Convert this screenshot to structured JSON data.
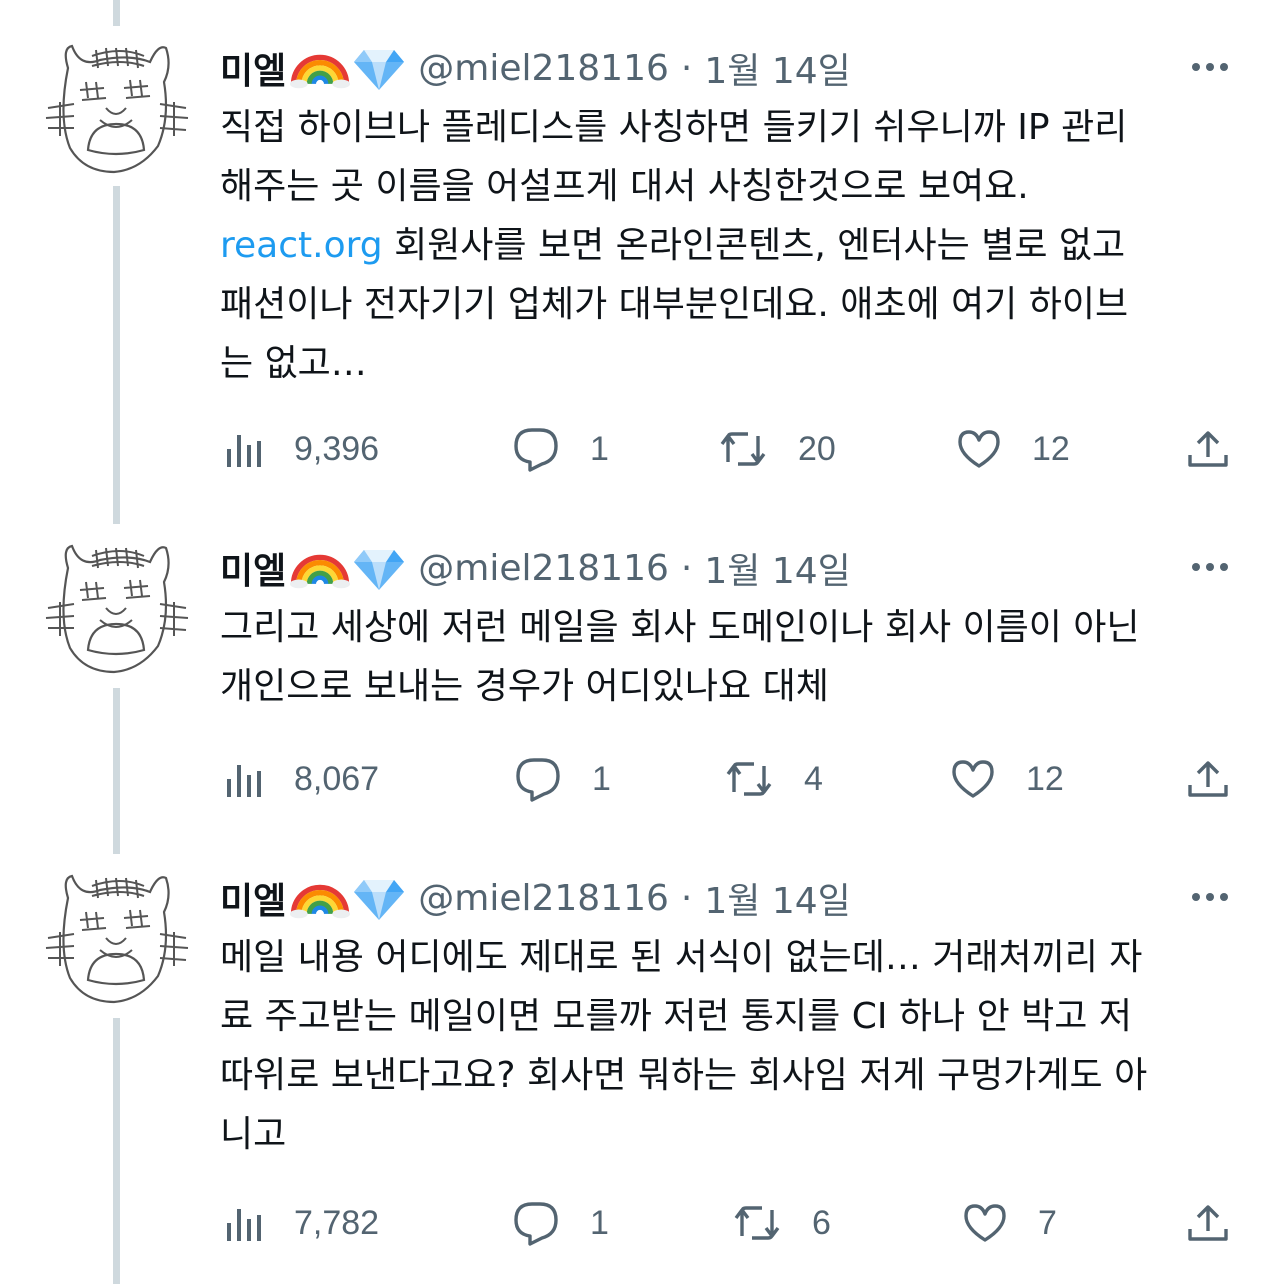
{
  "thread_line_color": "#cfd9de",
  "link_color": "#1d9bf0",
  "tweets": [
    {
      "author_name": "미엘",
      "badges": [
        "rainbow-emoji",
        "gem-emoji"
      ],
      "handle": "@miel218116",
      "separator": "·",
      "date": "1월 14일",
      "lines": [
        "직접 하이브나 플레디스를 사칭하면 들키기 쉬우니까 IP 관리",
        "해주는 곳 이름을 어설프게 대서 사칭한것으로 보여요."
      ],
      "link_text": "react.org",
      "link_line_rest": " 회원사를 보면 온라인콘텐츠, 엔터사는 별로 없고",
      "lines_after": [
        "패션이나 전자기기 업체가 대부분인데요. 애초에 여기 하이브",
        "는 없고…"
      ],
      "views": "9,396",
      "replies": "1",
      "retweets": "20",
      "likes": "12"
    },
    {
      "author_name": "미엘",
      "badges": [
        "rainbow-emoji",
        "gem-emoji"
      ],
      "handle": "@miel218116",
      "separator": "·",
      "date": "1월 14일",
      "lines": [
        "그리고 세상에 저런 메일을 회사 도메인이나 회사 이름이 아닌",
        "개인으로 보내는 경우가 어디있나요 대체"
      ],
      "views": "8,067",
      "replies": "1",
      "retweets": "4",
      "likes": "12"
    },
    {
      "author_name": "미엘",
      "badges": [
        "rainbow-emoji",
        "gem-emoji"
      ],
      "handle": "@miel218116",
      "separator": "·",
      "date": "1월 14일",
      "lines": [
        "메일 내용 어디에도 제대로 된 서식이 없는데… 거래처끼리 자",
        "료 주고받는 메일이면 모를까 저런 통지를 CI 하나 안 박고 저",
        "따위로 보낸다고요? 회사면 뭐하는 회사임 저게 구멍가게도 아",
        "니고"
      ],
      "views": "7,782",
      "replies": "1",
      "retweets": "6",
      "likes": "7"
    }
  ]
}
